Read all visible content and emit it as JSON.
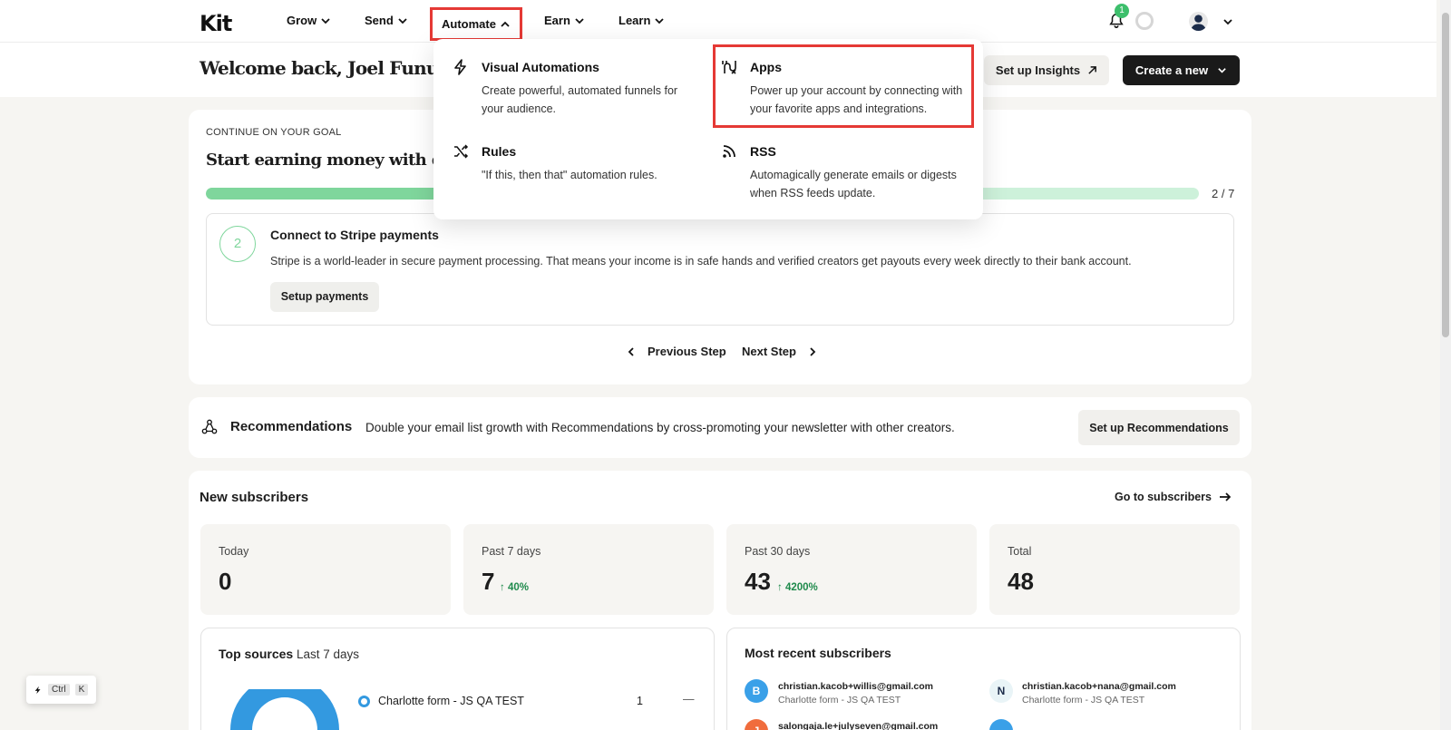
{
  "nav": {
    "logo": "Kit",
    "items": [
      {
        "label": "Grow"
      },
      {
        "label": "Send"
      },
      {
        "label": "Automate"
      },
      {
        "label": "Earn"
      },
      {
        "label": "Learn"
      }
    ],
    "notification_count": "1"
  },
  "header": {
    "welcome": "Welcome back, Joel Funu",
    "insights_button": "Set up Insights",
    "create_button": "Create a new"
  },
  "automate_menu": {
    "items": [
      {
        "title": "Visual Automations",
        "desc_line1": "Create powerful, automated funnels for",
        "desc_line2": "your audience.",
        "icon": "lightning-icon"
      },
      {
        "title": "Apps",
        "desc_line1": "Power up your account by connecting with",
        "desc_line2": "your favorite apps and integrations.",
        "icon": "plug-icon"
      },
      {
        "title": "Rules",
        "desc_line1": "\"If this, then that\" automation rules.",
        "desc_line2": "",
        "icon": "shuffle-icon"
      },
      {
        "title": "RSS",
        "desc_line1": "Automagically generate emails or digests",
        "desc_line2": "when RSS feeds update.",
        "icon": "rss-icon"
      }
    ]
  },
  "goal": {
    "eyebrow": "CONTINUE ON YOUR GOAL",
    "title": "Start earning money with digital",
    "progress_text": "2 / 7",
    "progress_fraction": 0.2857,
    "step": {
      "number": "2",
      "title": "Connect to Stripe payments",
      "description": "Stripe is a world-leader in secure payment processing. That means your income is in safe hands and verified creators get payouts every week directly to their bank account.",
      "button": "Setup payments"
    },
    "prev_label": "Previous Step",
    "next_label": "Next Step"
  },
  "recommendations": {
    "title": "Recommendations",
    "description": "Double your email list growth with Recommendations by cross-promoting your newsletter with other creators.",
    "button": "Set up Recommendations"
  },
  "subscribers": {
    "title": "New subscribers",
    "link": "Go to subscribers",
    "stats": [
      {
        "label": "Today",
        "value": "0",
        "delta": ""
      },
      {
        "label": "Past 7 days",
        "value": "7",
        "delta": "40%"
      },
      {
        "label": "Past 30 days",
        "value": "43",
        "delta": "4200%"
      },
      {
        "label": "Total",
        "value": "48",
        "delta": ""
      }
    ]
  },
  "top_sources": {
    "title": "Top sources",
    "period": "Last 7 days",
    "rows": [
      {
        "name": "Charlotte form - JS QA TEST",
        "count": "1",
        "trend": "—"
      }
    ]
  },
  "recent": {
    "title": "Most recent subscribers",
    "items": [
      {
        "initial": "B",
        "email": "christian.kacob+willis@gmail.com",
        "source": "Charlotte form - JS QA TEST",
        "color": "#3aa0e8"
      },
      {
        "initial": "N",
        "email": "christian.kacob+nana@gmail.com",
        "source": "Charlotte form - JS QA TEST",
        "color": "#e9f4f7"
      },
      {
        "initial": "J",
        "email": "salongaja.le+julyseven@gmail.com",
        "source": "",
        "color": "#f06c3c"
      }
    ]
  },
  "shortcut": {
    "ctrl": "Ctrl",
    "key": "K"
  },
  "colors": {
    "accent_green": "#7fd69c",
    "highlight_red": "#e53935",
    "dark_button": "#1a1a1a"
  }
}
